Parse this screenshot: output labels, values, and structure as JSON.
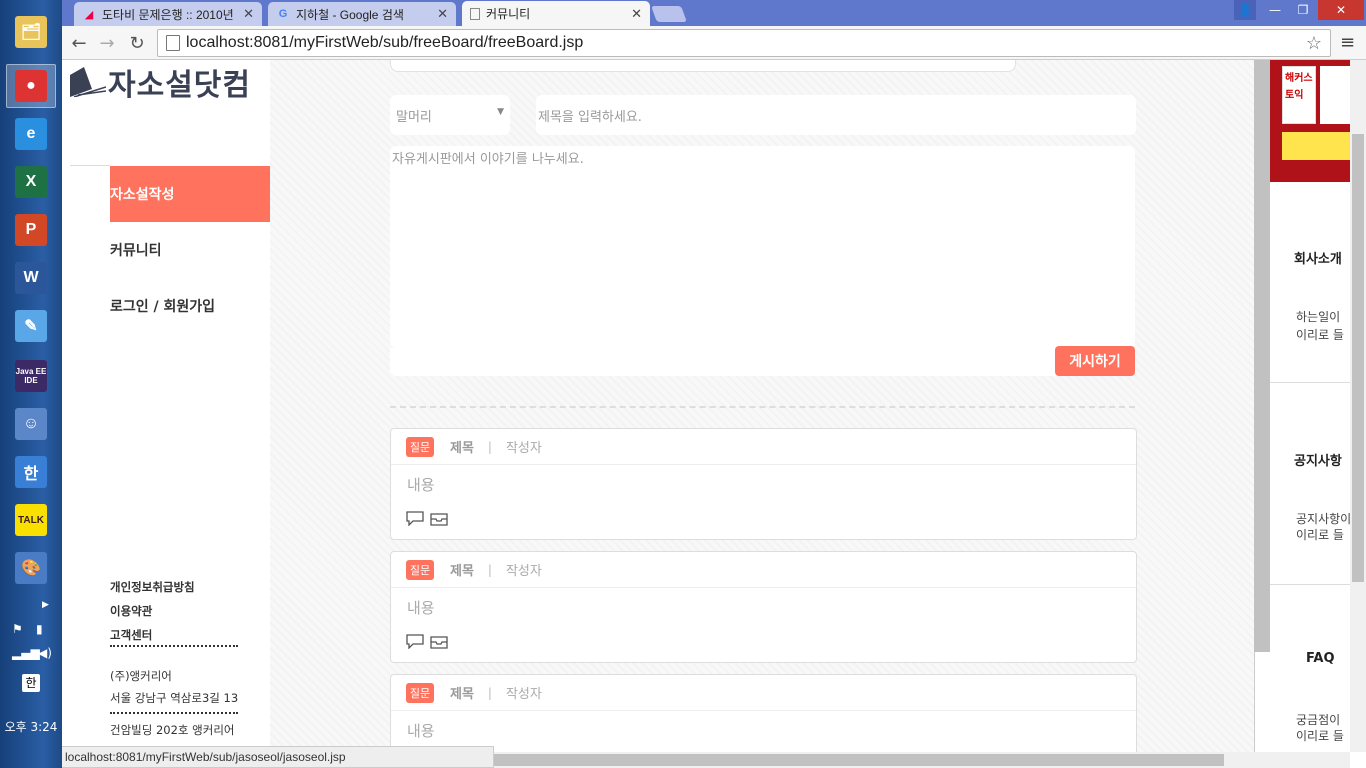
{
  "taskbar": {
    "apps": [
      {
        "name": "explorer",
        "glyph": "🗂",
        "bg": "#e9c45a"
      },
      {
        "name": "chrome",
        "glyph": "●",
        "bg": "#d33"
      },
      {
        "name": "internet-explorer",
        "glyph": "e",
        "bg": "#2b8fe0"
      },
      {
        "name": "excel",
        "glyph": "X",
        "bg": "#1e7145"
      },
      {
        "name": "powerpoint",
        "glyph": "P",
        "bg": "#d24726"
      },
      {
        "name": "word",
        "glyph": "W",
        "bg": "#2b579a"
      },
      {
        "name": "notepad",
        "glyph": "✎",
        "bg": "#5aa7e8"
      },
      {
        "name": "java-ee-ide",
        "glyph": "Java EE IDE",
        "bg": "#3b2a66"
      },
      {
        "name": "messenger",
        "glyph": "☺",
        "bg": "#5b86c7"
      },
      {
        "name": "hangul",
        "glyph": "한",
        "bg": "#3a7fd6"
      },
      {
        "name": "kakaotalk",
        "glyph": "TALK",
        "bg": "#f9e000"
      },
      {
        "name": "paint",
        "glyph": "🎨",
        "bg": "#4a7bc5"
      }
    ],
    "ime": "한",
    "clock": "오후 3:24"
  },
  "browser": {
    "tabs": [
      {
        "title": "도타비 문제은행 :: 2010년",
        "active": false
      },
      {
        "title": "지하철 - Google 검색",
        "active": false
      },
      {
        "title": "커뮤니티",
        "active": true
      }
    ],
    "url": "localhost:8081/myFirstWeb/sub/freeBoard/freeBoard.jsp",
    "status_url": "localhost:8081/myFirstWeb/sub/jasoseol/jasoseol.jsp"
  },
  "site": {
    "logo_text": "자소설닷컴",
    "nav": [
      {
        "label": "자소설작성",
        "active": true
      },
      {
        "label": "커뮤니티",
        "active": false
      },
      {
        "label": "로그인 / 회원가입",
        "active": false
      }
    ],
    "footer_links": [
      "개인정보취급방침",
      "이용약관",
      "고객센터"
    ],
    "company": [
      "(주)앵커리어",
      "서울 강남구 역삼로3길 13",
      "건암빌딩 202호 앵커리어"
    ],
    "accent": "#ff735e"
  },
  "form": {
    "prefix_placeholder": "말머리",
    "title_placeholder": "제목을 입력하세요.",
    "body_placeholder": "자유게시판에서 이야기를 나누세요.",
    "submit_label": "게시하기"
  },
  "posts": [
    {
      "badge": "질문",
      "title": "제목",
      "author": "작성자",
      "content": "내용"
    },
    {
      "badge": "질문",
      "title": "제목",
      "author": "작성자",
      "content": "내용"
    },
    {
      "badge": "질문",
      "title": "제목",
      "author": "작성자",
      "content": "내용"
    }
  ],
  "sidebar": {
    "ad_text1": "해커스",
    "ad_text2": "토익",
    "sections": [
      {
        "title": "회사소개",
        "desc1": "하는일이",
        "desc2": "이리로 들"
      },
      {
        "title": "공지사항",
        "desc1": "공지사항이",
        "desc2": "이리로 들"
      },
      {
        "title": "FAQ",
        "desc1": "궁금점이",
        "desc2": "이리로 들"
      }
    ]
  }
}
